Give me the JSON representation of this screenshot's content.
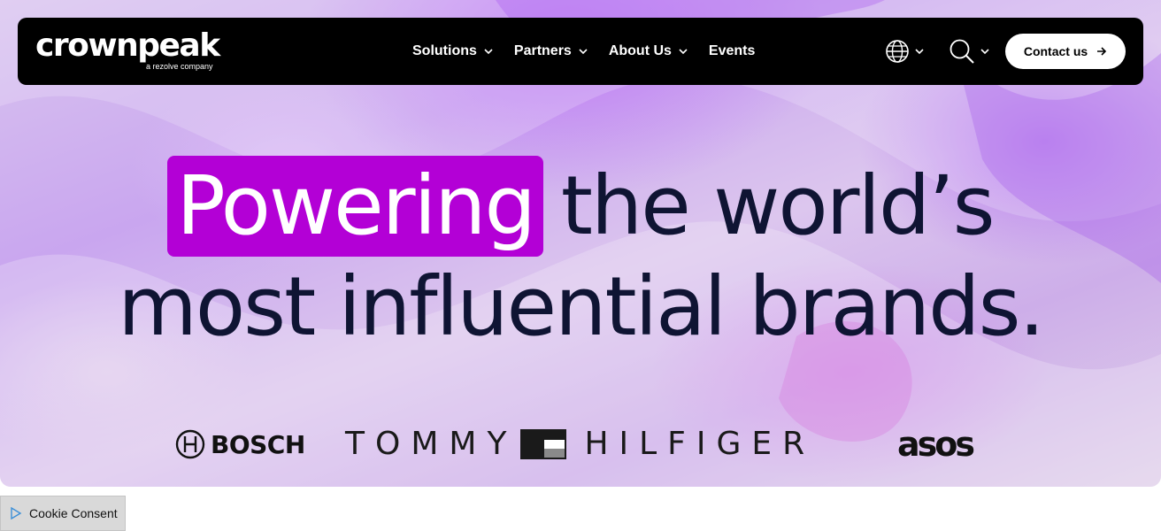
{
  "nav": {
    "logo_text": "crownpeak",
    "logo_tagline": "a rezolve company",
    "menu": [
      {
        "label": "Solutions",
        "has_dropdown": true
      },
      {
        "label": "Partners",
        "has_dropdown": true
      },
      {
        "label": "About Us",
        "has_dropdown": true
      },
      {
        "label": "Events",
        "has_dropdown": false
      }
    ],
    "language_icon": "globe-icon",
    "search_icon": "search-icon",
    "contact_label": "Contact us",
    "contact_icon": "arrow-right-icon"
  },
  "hero": {
    "headline_highlight": "Powering",
    "headline_rest": "the world’s",
    "headline_line2": "most influential brands.",
    "highlight_color": "#b300d6",
    "text_color": "#0f1433"
  },
  "brands": [
    {
      "name": "BOSCH"
    },
    {
      "name_left": "TOMMY",
      "name_right": "HILFIGER"
    },
    {
      "name": "asos"
    }
  ],
  "cookie": {
    "label": "Cookie Consent",
    "icon": "play-icon"
  }
}
